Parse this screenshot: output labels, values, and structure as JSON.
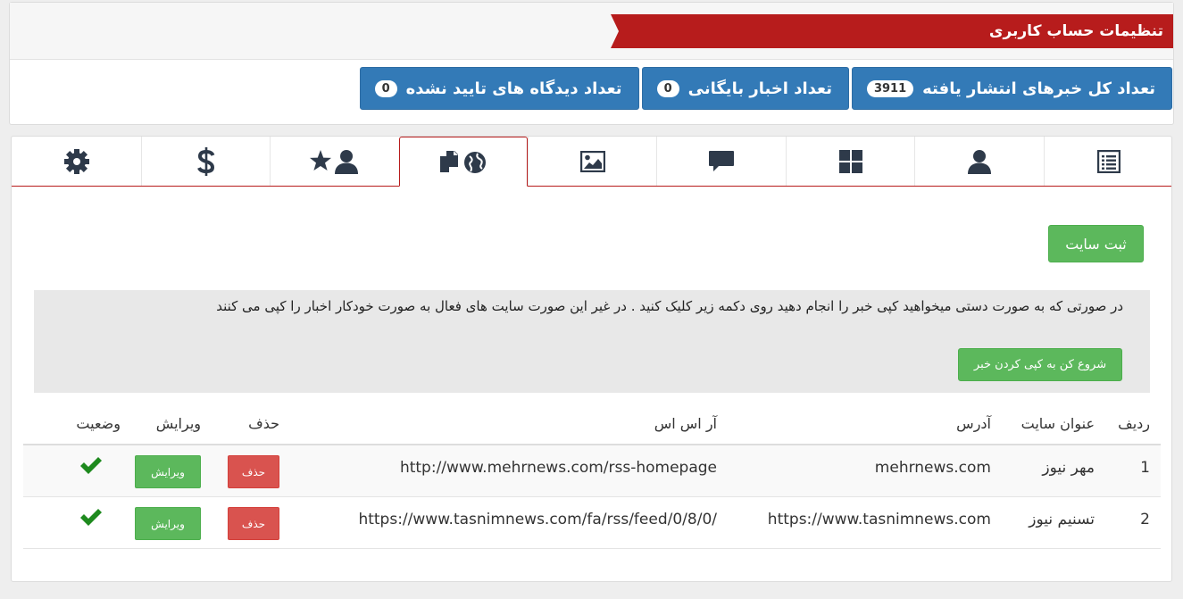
{
  "header": {
    "title": "تنظیمات حساب کاربری"
  },
  "stats": [
    {
      "label": "تعداد کل خبرهای انتشار یافته",
      "count": "3911"
    },
    {
      "label": "تعداد اخبار بایگانی",
      "count": "0"
    },
    {
      "label": "تعداد دیدگاه های تایید نشده",
      "count": "0"
    }
  ],
  "tabs": [
    {
      "icon": "list-alt-icon"
    },
    {
      "icon": "user-icon"
    },
    {
      "icon": "dashboard-grid-icon"
    },
    {
      "icon": "comment-icon"
    },
    {
      "icon": "image-icon"
    },
    {
      "icon": "copy-globe-icon",
      "active": true
    },
    {
      "icon": "user-star-icon"
    },
    {
      "icon": "dollar-icon"
    },
    {
      "icon": "gear-icon"
    }
  ],
  "register_button": "ثبت سایت",
  "notice": {
    "text": "در صورتی که به صورت دستی میخواهید کپی خبر را انجام دهید روی دکمه زیر کلیک کنید . در غیر این صورت سایت های فعال به صورت خودکار اخبار را کپی می کنند",
    "button": "شروع کن به کپی کردن خبر"
  },
  "table": {
    "headers": {
      "index": "ردیف",
      "title": "عنوان سایت",
      "address": "آدرس",
      "rss": "آر اس اس",
      "delete": "حذف",
      "edit": "ویرایش",
      "status": "وضعیت"
    },
    "rows": [
      {
        "index": "1",
        "title": "مهر نیوز",
        "address": "mehrnews.com",
        "rss": "http://www.mehrnews.com/rss-homepage",
        "delete": "حذف",
        "edit": "ویرایش",
        "status_icon": "check-icon"
      },
      {
        "index": "2",
        "title": "تسنیم نیوز",
        "address": "https://www.tasnimnews.com",
        "rss": "https://www.tasnimnews.com/fa/rss/feed/0/8/0/",
        "delete": "حذف",
        "edit": "ویرایش",
        "status_icon": "check-icon"
      }
    ]
  },
  "colors": {
    "accent_red": "#b71c1c",
    "primary_blue": "#337ab7",
    "success_green": "#5cb85c",
    "danger_red": "#d9534f",
    "icon_dark": "#2e3a4a",
    "check_green": "#1e8a1e"
  }
}
